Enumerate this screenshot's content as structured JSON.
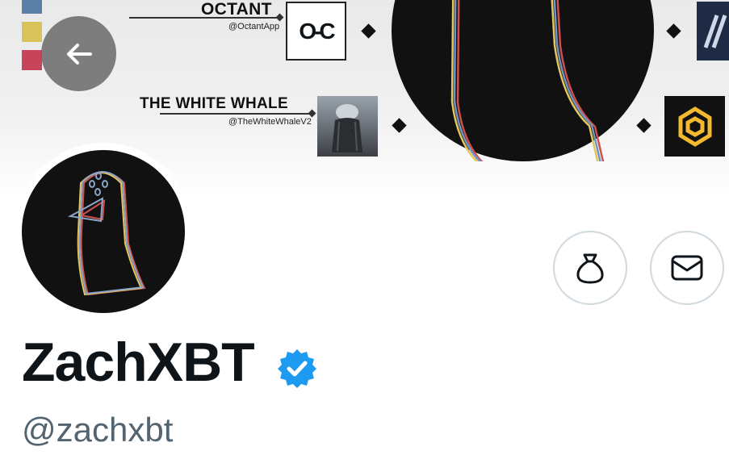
{
  "profile": {
    "display_name": "ZachXBT",
    "handle": "@zachxbt",
    "verified": true,
    "verified_color": "#1d9bf0"
  },
  "banner": {
    "sponsors": [
      {
        "name": "OCTANT",
        "handle": "@OctantApp",
        "logo_text": "O-C"
      },
      {
        "name": "THE WHITE WHALE",
        "handle": "@TheWhiteWhaleV2"
      }
    ],
    "swatch_colors": [
      "#5c7fa8",
      "#d8c35a",
      "#c6455a"
    ]
  },
  "actions": {
    "tip_icon": "money-bag-icon",
    "message_icon": "envelope-icon"
  },
  "nav": {
    "back_icon": "arrow-left-icon"
  }
}
